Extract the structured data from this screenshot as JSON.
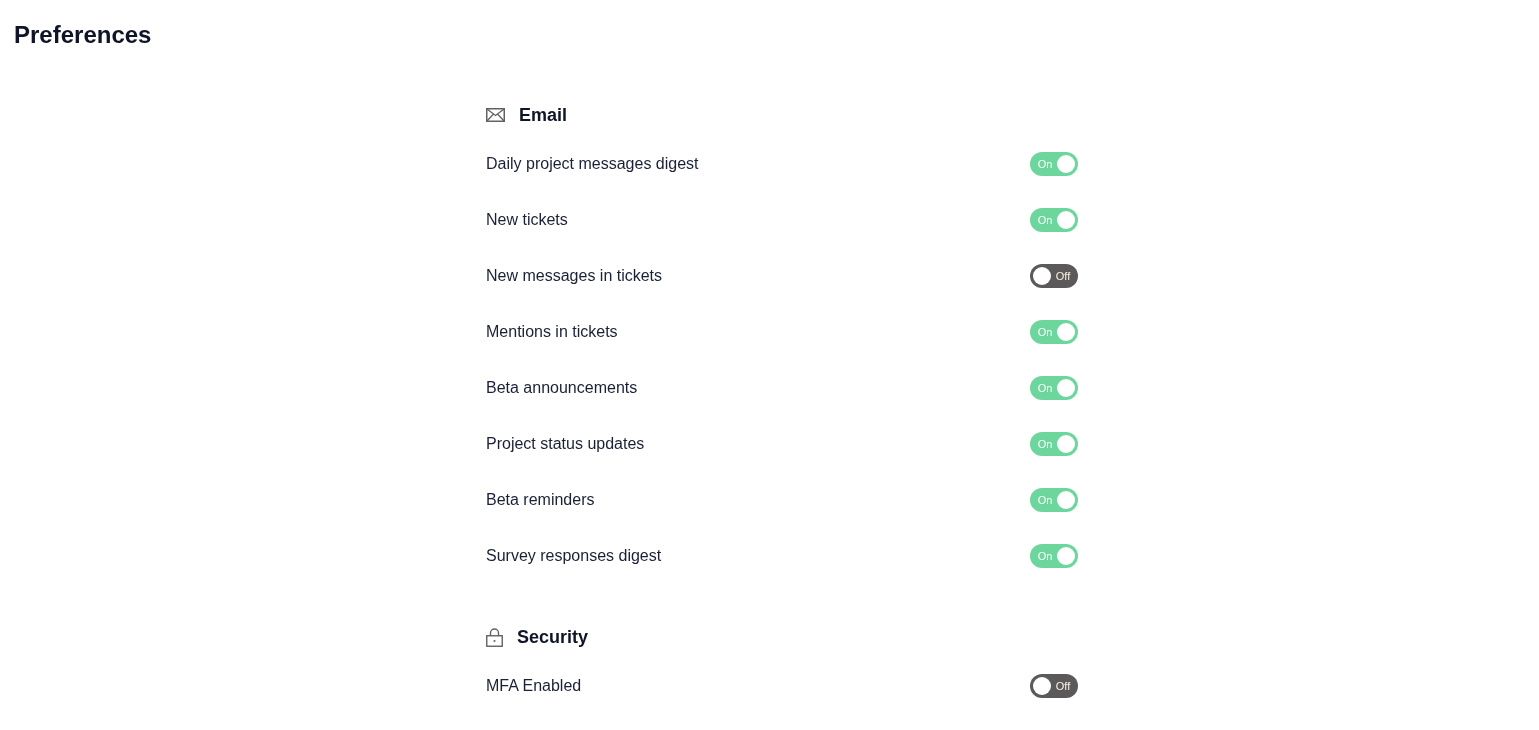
{
  "page": {
    "title": "Preferences"
  },
  "sections": [
    {
      "kind": "email",
      "title": "Email",
      "settings": [
        {
          "label": "Daily project messages digest",
          "on": true,
          "state_label": "On"
        },
        {
          "label": "New tickets",
          "on": true,
          "state_label": "On"
        },
        {
          "label": "New messages in tickets",
          "on": false,
          "state_label": "Off"
        },
        {
          "label": "Mentions in tickets",
          "on": true,
          "state_label": "On"
        },
        {
          "label": "Beta announcements",
          "on": true,
          "state_label": "On"
        },
        {
          "label": "Project status updates",
          "on": true,
          "state_label": "On"
        },
        {
          "label": "Beta reminders",
          "on": true,
          "state_label": "On"
        },
        {
          "label": "Survey responses digest",
          "on": true,
          "state_label": "On"
        }
      ]
    },
    {
      "kind": "security",
      "title": "Security",
      "settings": [
        {
          "label": "MFA Enabled",
          "on": false,
          "state_label": "Off"
        }
      ]
    }
  ]
}
